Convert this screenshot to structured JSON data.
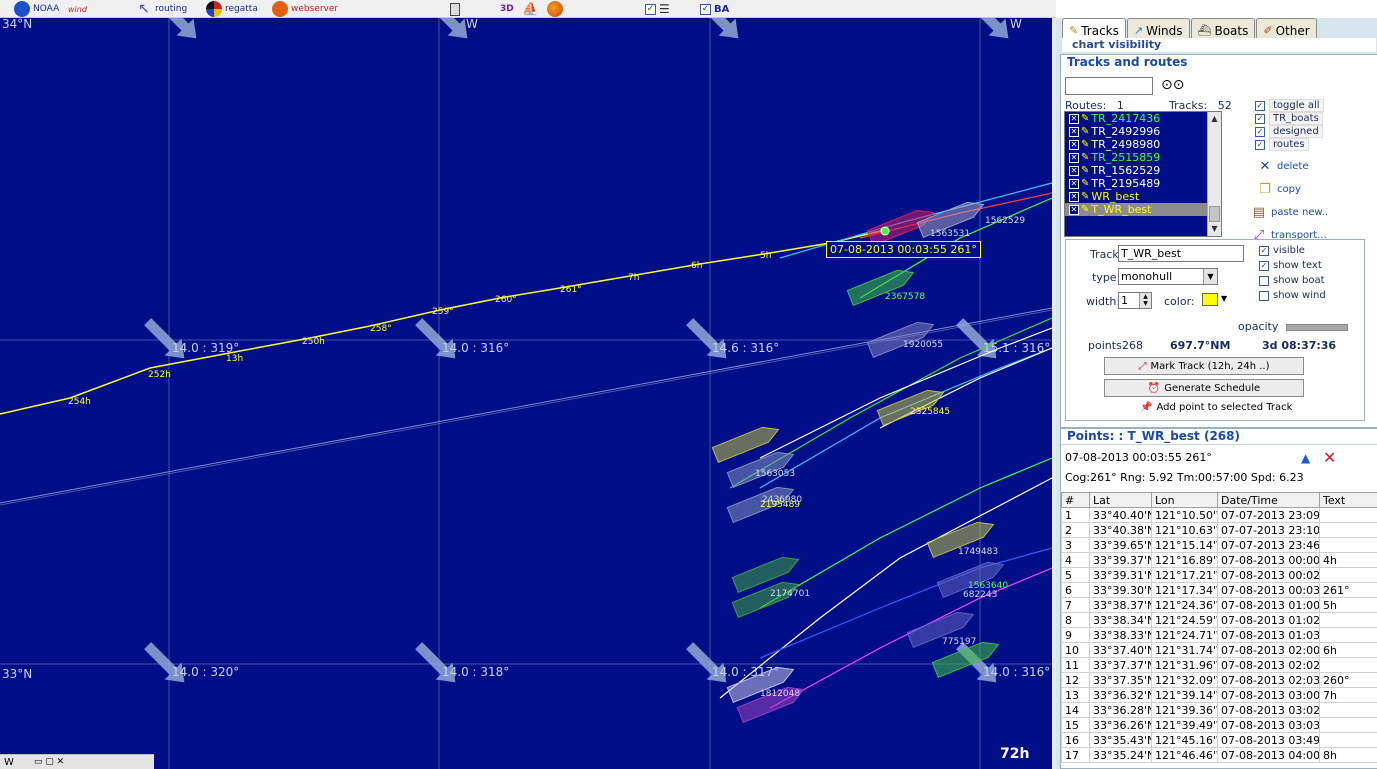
{
  "toolbar": {
    "items": [
      {
        "label": "NOAA",
        "icon": "noaa-globe-icon",
        "color": "#1e50c8"
      },
      {
        "label": "wind",
        "icon": "wind-icon",
        "color": "#c02020"
      },
      {
        "label": "routing",
        "icon": "routing-icon",
        "color": "#3050a0"
      },
      {
        "label": "regatta",
        "icon": "regatta-icon",
        "color": "#d02020"
      },
      {
        "label": "webserver",
        "icon": "webserver-icon",
        "color": "#e06010"
      }
    ],
    "threed_label": "3D",
    "ba_label": "BA"
  },
  "map": {
    "grid_labels": {
      "lat_top": "34°N",
      "lat_bottom": "33°N",
      "lon_w1": "W",
      "lon_w2": "W"
    },
    "wind_labels": [
      "14.0 : 319°",
      "14.0 : 316°",
      "14.6 : 316°",
      "15.1 : 316°",
      "14.0 : 320°",
      "14.0 : 318°",
      "14.0 : 317°",
      "14.0 : 316°"
    ],
    "time_labels": [
      "5h",
      "7h",
      "6h",
      "13h",
      "261°",
      "260°",
      "259°",
      "258°",
      "254h",
      "252h",
      "250h"
    ],
    "boat_labels": [
      "1563531",
      "1562529",
      "2367578",
      "1920055",
      "2325845",
      "1563053",
      "2436980",
      "2195489",
      "1749483",
      "2174701",
      "1563640",
      "682243",
      "775197",
      "1812048"
    ],
    "tooltip": "07-08-2013 00:03:55 261°",
    "zoom_label": "72h"
  },
  "panel": {
    "tabs": [
      "Tracks",
      "Winds",
      "Boats",
      "Other"
    ],
    "chart_visibility": "chart visibility",
    "tracks_routes_title": "Tracks and routes",
    "routes_label": "Routes:",
    "routes_count": "1",
    "tracks_label": "Tracks:",
    "tracks_count": "52",
    "track_items": [
      {
        "name": "TR_2417436",
        "color": "#40ff40"
      },
      {
        "name": "TR_2492996",
        "color": "#ffffff"
      },
      {
        "name": "TR_2498980",
        "color": "#ffffff"
      },
      {
        "name": "TR_2515859",
        "color": "#40ff40"
      },
      {
        "name": "TR_1562529",
        "color": "#ffffff"
      },
      {
        "name": "TR_2195489",
        "color": "#ffffff"
      },
      {
        "name": "WR_best",
        "color": "#ffff00"
      },
      {
        "name": "T_WR_best",
        "color": "#ffff00"
      }
    ],
    "right_checks": [
      "toggle all",
      "TR_boats",
      "designed",
      "routes"
    ],
    "actions": [
      "delete",
      "copy",
      "paste new..",
      "transport..."
    ],
    "track_label": "Track:",
    "track_value": "T_WR_best",
    "type_label": "type:",
    "type_value": "monohull",
    "width_label": "width:",
    "width_value": "1",
    "color_label": "color:",
    "track_color": "#ffff00",
    "opts": [
      "visible",
      "show text",
      "show boat",
      "show wind"
    ],
    "opacity_label": "opacity",
    "points_label": "points",
    "points_value": "268",
    "distance_value": "697.7°NM",
    "duration_value": "3d 08:37:36",
    "mark_track_btn": "Mark Track (12h, 24h ..)",
    "generate_schedule_btn": "Generate Schedule",
    "add_point_btn": "Add point to selected Track"
  },
  "points": {
    "title": "Points: : T_WR_best (268)",
    "selected_info": "07-08-2013 00:03:55 261°",
    "cog_info": "Cog:261° Rng:  5.92 Tm:00:57:00 Spd:  6.23",
    "columns": [
      "#",
      "Lat",
      "Lon",
      "Date/Time",
      "Text"
    ],
    "rows": [
      [
        "1",
        "33°40.40'N",
        "121°10.50'W",
        "07-07-2013 23:09:18",
        ""
      ],
      [
        "2",
        "33°40.38'N",
        "121°10.63'W",
        "07-07-2013 23:10:18",
        ""
      ],
      [
        "3",
        "33°39.65'N",
        "121°15.14'W",
        "07-07-2013 23:46:18",
        ""
      ],
      [
        "4",
        "33°39.37'N",
        "121°16.89'W",
        "07-08-2013 00:00:18",
        "4h"
      ],
      [
        "5",
        "33°39.31'N",
        "121°17.21'W",
        "07-08-2013 00:02:55",
        ""
      ],
      [
        "6",
        "33°39.30'N",
        "121°17.34'W",
        "07-08-2013 00:03:55",
        "261°"
      ],
      [
        "7",
        "33°38.37'N",
        "121°24.36'W",
        "07-08-2013 01:00:55",
        "5h"
      ],
      [
        "8",
        "33°38.34'N",
        "121°24.59'W",
        "07-08-2013 01:02:45",
        ""
      ],
      [
        "9",
        "33°38.33'N",
        "121°24.71'W",
        "07-08-2013 01:03:45",
        ""
      ],
      [
        "10",
        "33°37.40'N",
        "121°31.74'W",
        "07-08-2013 02:00:45",
        "6h"
      ],
      [
        "11",
        "33°37.37'N",
        "121°31.96'W",
        "07-08-2013 02:02:34",
        ""
      ],
      [
        "12",
        "33°37.35'N",
        "121°32.09'W",
        "07-08-2013 02:03:34",
        "260°"
      ],
      [
        "13",
        "33°36.32'N",
        "121°39.14'W",
        "07-08-2013 03:00:34",
        "7h"
      ],
      [
        "14",
        "33°36.28'N",
        "121°39.36'W",
        "07-08-2013 03:02:23",
        ""
      ],
      [
        "15",
        "33°36.26'N",
        "121°39.49'W",
        "07-08-2013 03:03:23",
        ""
      ],
      [
        "16",
        "33°35.43'N",
        "121°45.16'W",
        "07-08-2013 03:49:23",
        ""
      ],
      [
        "17",
        "33°35.24'N",
        "121°46.46'W",
        "07-08-2013 04:00:23",
        "8h"
      ]
    ]
  },
  "taskbar": {
    "label": "W"
  }
}
